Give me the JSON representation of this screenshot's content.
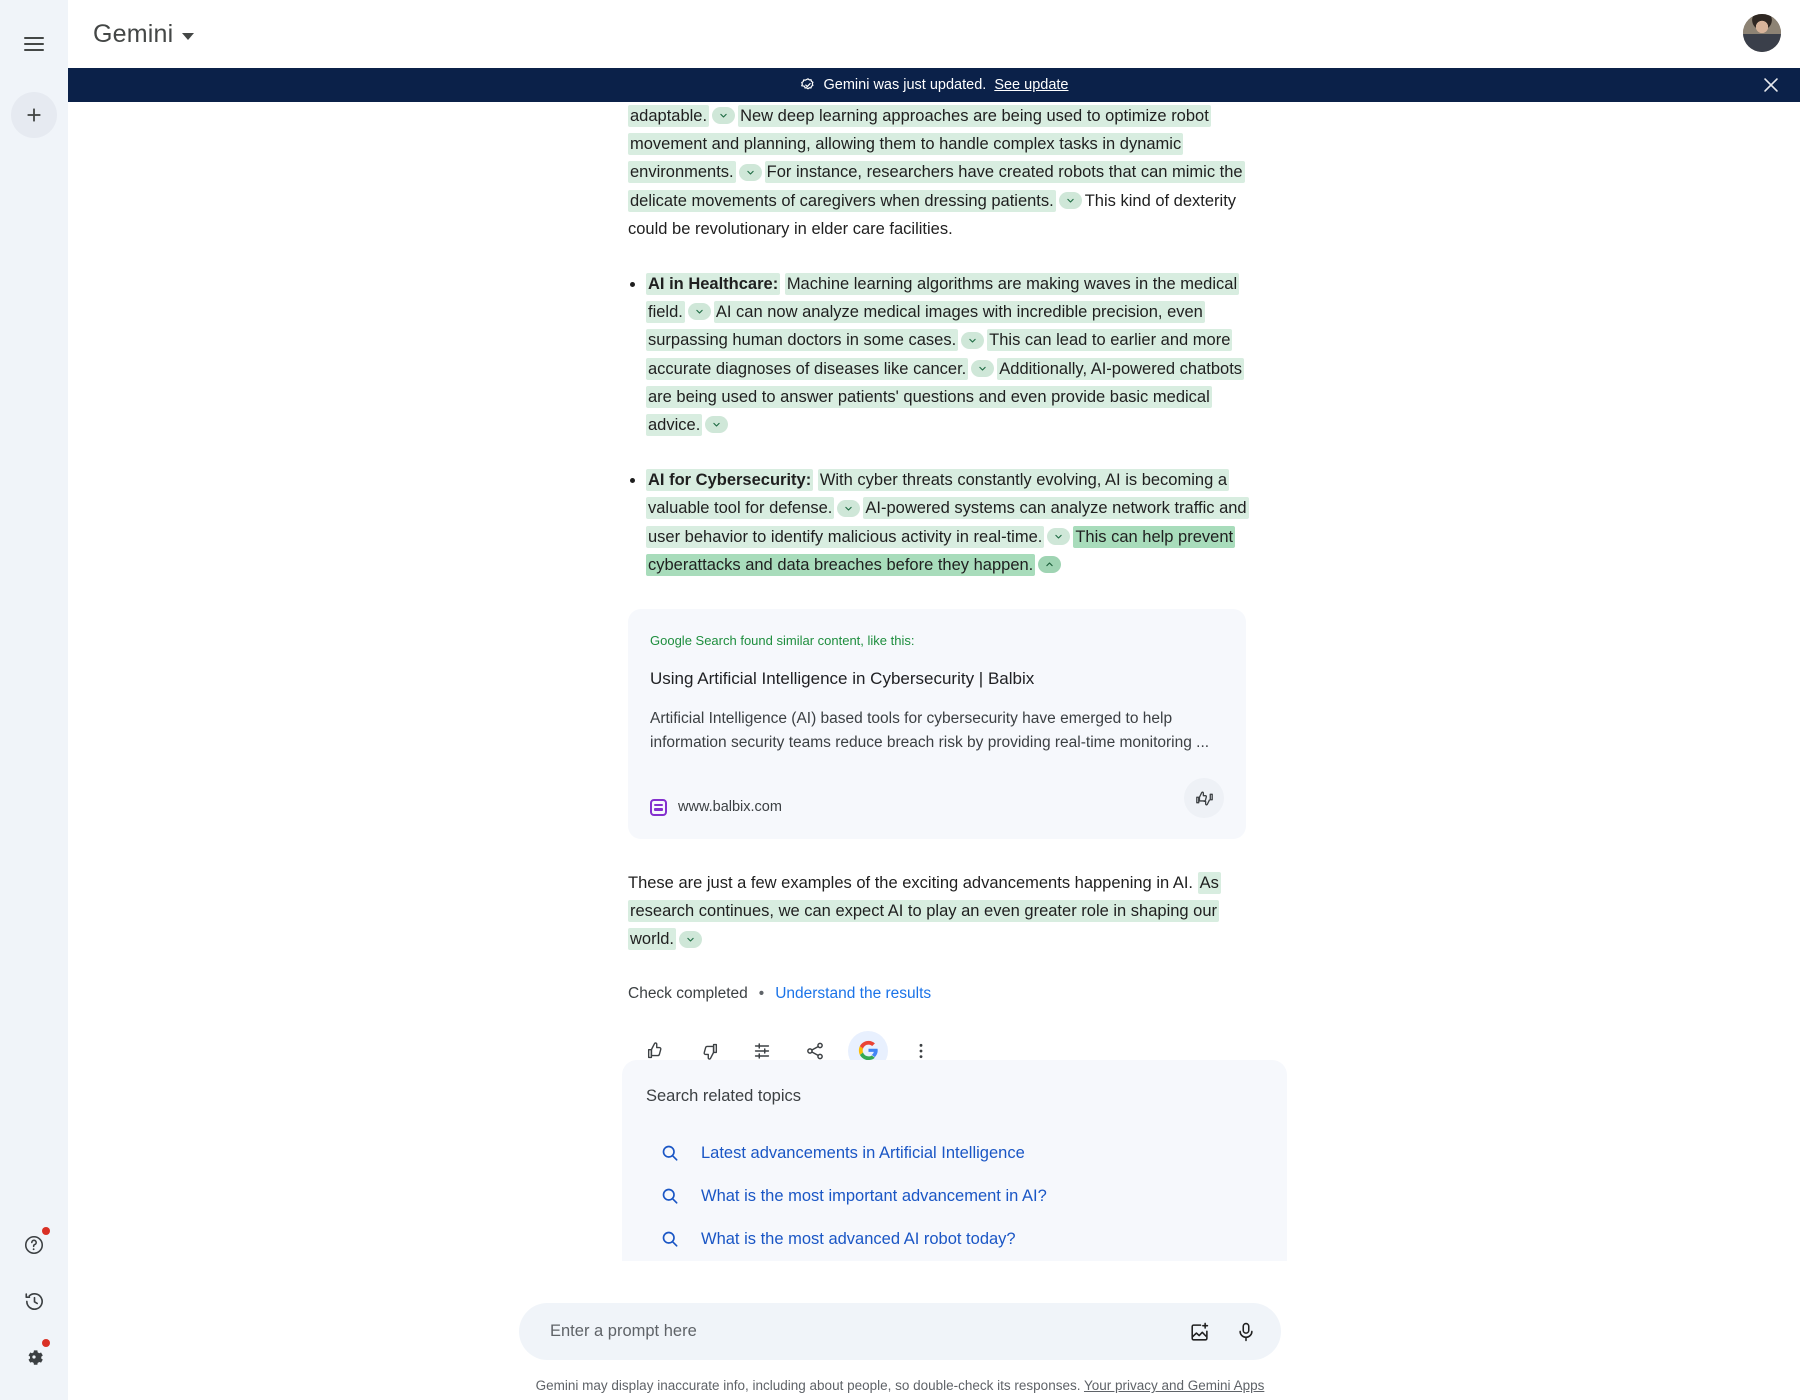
{
  "rail": {
    "menu_icon": "hamburger-menu-icon",
    "new_chat_icon": "plus-icon",
    "help_icon": "help-circle-icon",
    "history_icon": "history-clock-icon",
    "settings_icon": "gear-icon"
  },
  "header": {
    "brand": "Gemini",
    "caret_icon": "chevron-down-icon",
    "avatar_name": "user-avatar"
  },
  "banner": {
    "icon": "check-badge-icon",
    "message": "Gemini was just updated.",
    "link": "See update",
    "close_icon": "close-icon"
  },
  "answer": {
    "p0_a": "adaptable.",
    "p0_b": "New deep learning approaches are being used to optimize robot movement and planning, allowing them to handle complex tasks in dynamic environments.",
    "p0_c": "For instance, researchers have created robots that can mimic the delicate movements of caregivers when dressing patients.",
    "p0_tail": "This kind of dexterity could be revolutionary in elder care facilities.",
    "bullets": [
      {
        "lead": "AI in Healthcare:",
        "s1": "Machine learning algorithms are making waves in the medical field.",
        "s2": "AI can now analyze medical images with incredible precision, even surpassing human doctors in some cases.",
        "s3": "This can lead to earlier and more accurate diagnoses of diseases like cancer.",
        "s4": "Additionally, AI-powered chatbots are being used to answer patients' questions and even provide basic medical advice."
      },
      {
        "lead": "AI for Cybersecurity:",
        "s1": "With cyber threats constantly evolving, AI is becoming a valuable tool for defense.",
        "s2": "AI-powered systems can analyze network traffic and user behavior to identify malicious activity in real-time.",
        "s3": "This can help prevent cyberattacks and data breaches before they happen."
      }
    ],
    "closing_plain": "These are just a few examples of the exciting advancements happening in AI.",
    "closing_hl": "As research continues, we can expect AI to play an even greater role in shaping our world."
  },
  "source_card": {
    "label": "Google Search found similar content, like this:",
    "title": "Using Artificial Intelligence in Cybersecurity | Balbix",
    "snippet": "Artificial Intelligence (AI) based tools for cybersecurity have emerged to help information security teams reduce breach risk by providing real-time monitoring ...",
    "domain": "www.balbix.com",
    "favicon_name": "balbix-favicon",
    "feedback_icon": "thumbs-up-down-icon"
  },
  "check": {
    "status": "Check completed",
    "separator": "•",
    "link": "Understand the results"
  },
  "actions": [
    {
      "name": "thumb-up-icon",
      "label": "Good response"
    },
    {
      "name": "thumb-down-icon",
      "label": "Bad response"
    },
    {
      "name": "tune-icon",
      "label": "Modify response"
    },
    {
      "name": "share-icon",
      "label": "Share & export"
    },
    {
      "name": "google-g-icon",
      "label": "Double-check response"
    },
    {
      "name": "more-vert-icon",
      "label": "More"
    }
  ],
  "related": {
    "title": "Search related topics",
    "items": [
      "Latest advancements in Artificial Intelligence",
      "What is the most important advancement in AI?",
      "What is the most advanced AI robot today?"
    ],
    "item_icon": "search-icon"
  },
  "composer": {
    "placeholder": "Enter a prompt here",
    "value": "",
    "image_icon": "add-image-icon",
    "mic_icon": "microphone-icon"
  },
  "disclaimer": {
    "text": "Gemini may display inaccurate info, including about people, so double-check its responses.",
    "link": "Your privacy and Gemini Apps"
  },
  "colors": {
    "banner_bg": "#0b2149",
    "highlight": "#d8ede0",
    "highlight_strong": "#a8dcbb",
    "link_blue": "#1a73e8",
    "source_green": "#1e8e3e",
    "badge_red": "#d93025"
  }
}
